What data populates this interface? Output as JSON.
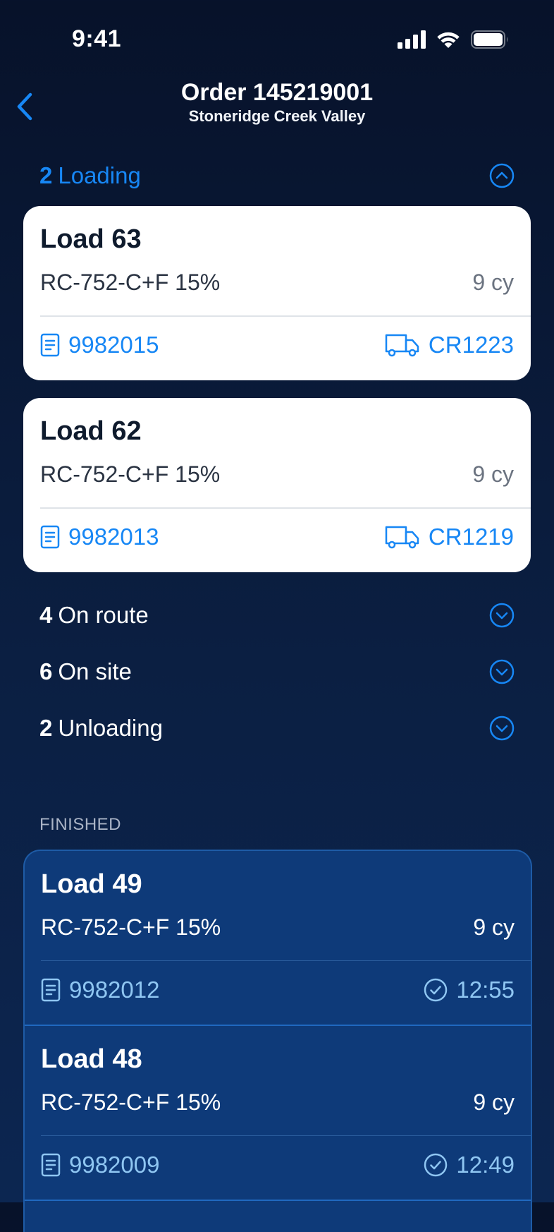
{
  "status_bar": {
    "time": "9:41"
  },
  "nav": {
    "title": "Order 145219001",
    "subtitle": "Stoneridge Creek Valley"
  },
  "groups": {
    "loading": {
      "count": "2",
      "label": "Loading"
    },
    "on_route": {
      "count": "4",
      "label": "On route"
    },
    "on_site": {
      "count": "6",
      "label": "On site"
    },
    "unloading": {
      "count": "2",
      "label": "Unloading"
    }
  },
  "loading_loads": [
    {
      "title": "Load 63",
      "mix": "RC-752-C+F 15%",
      "qty": "9 cy",
      "ticket": "9982015",
      "truck": "CR1223"
    },
    {
      "title": "Load 62",
      "mix": "RC-752-C+F 15%",
      "qty": "9 cy",
      "ticket": "9982013",
      "truck": "CR1219"
    }
  ],
  "finished": {
    "label": "FINISHED",
    "loads": [
      {
        "title": "Load 49",
        "mix": "RC-752-C+F 15%",
        "qty": "9 cy",
        "ticket": "9982012",
        "time": "12:55"
      },
      {
        "title": "Load 48",
        "mix": "RC-752-C+F 15%",
        "qty": "9 cy",
        "ticket": "9982009",
        "time": "12:49"
      }
    ]
  },
  "colors": {
    "accent": "#1787f5",
    "card_bg": "#ffffff",
    "finished_bg": "#0e3a79",
    "finished_text": "#8fc6f2"
  }
}
